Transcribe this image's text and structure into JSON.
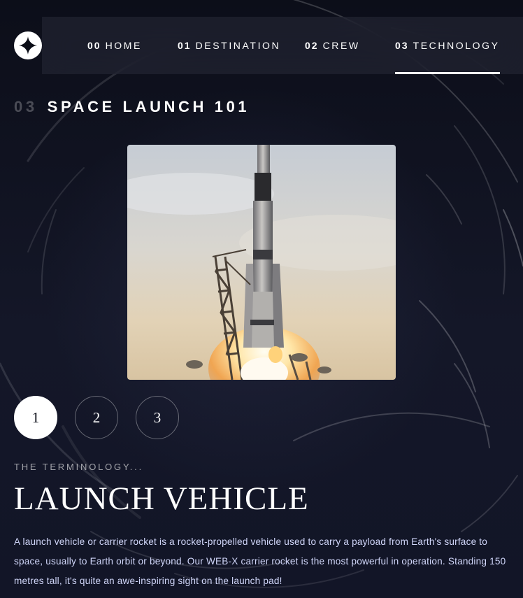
{
  "colors": {
    "background": "#0b0d17",
    "accent": "#ffffff",
    "body_text": "#d0d6f9"
  },
  "header": {
    "logo_icon": "four-point-star-icon",
    "nav": [
      {
        "num": "00",
        "label": "HOME",
        "active": false
      },
      {
        "num": "01",
        "label": "DESTINATION",
        "active": false
      },
      {
        "num": "02",
        "label": "CREW",
        "active": false
      },
      {
        "num": "03",
        "label": "TECHNOLOGY",
        "active": true
      }
    ]
  },
  "section": {
    "num": "03",
    "title": "SPACE LAUNCH 101"
  },
  "pager": {
    "items": [
      "1",
      "2",
      "3"
    ],
    "active_index": 0
  },
  "content": {
    "eyebrow": "THE TERMINOLOGY...",
    "headline": "LAUNCH VEHICLE",
    "body": "A launch vehicle or carrier rocket is a rocket-propelled vehicle used to carry a payload from Earth's surface to space, usually to Earth orbit or beyond. Our WEB-X carrier rocket is the most powerful in operation. Standing 150 metres tall, it's quite an awe-inspiring sight on the launch pad!"
  }
}
